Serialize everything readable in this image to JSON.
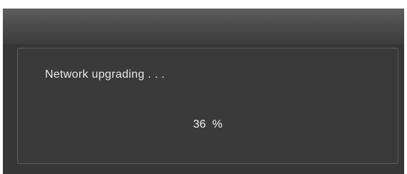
{
  "dialog": {
    "title": "",
    "message": "Network upgrading . . .",
    "progress_text": "36  %",
    "progress_percent": 36
  },
  "colors": {
    "dialog_background": "#373737",
    "title_bar_top": "#5e5e5e",
    "title_bar_bottom": "#3d3d3d",
    "panel_border": "#5c5c5c",
    "text": "#e8e8e8"
  }
}
